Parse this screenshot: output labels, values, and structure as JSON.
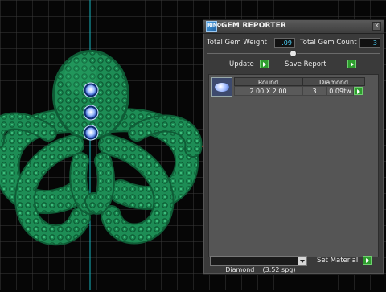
{
  "panel": {
    "title": "GEM REPORTER",
    "icon_text": "RINO\nGOLD",
    "close_label": "x",
    "stats": {
      "total_weight_label": "Total Gem Weight",
      "total_weight_value": ".09",
      "total_count_label": "Total Gem Count",
      "total_count_value": "3"
    },
    "buttons": {
      "update_label": "Update",
      "save_report_label": "Save Report",
      "set_material_label": "Set Material"
    },
    "table": {
      "headers": [
        "Round",
        "Diamond"
      ],
      "rows": [
        {
          "size": "2.00 X 2.00",
          "count": "3",
          "weight": "0.09tw"
        }
      ]
    },
    "material_select": {
      "value": "Diamond    (3.52 spg)"
    }
  },
  "colors": {
    "accent_button": "#2e9d2e",
    "value_text": "#4fd6ff",
    "model": "#1f8a52",
    "gems": "#9fc4ff"
  },
  "icons": [
    "gem-thumbnail-icon",
    "play-arrow-icon",
    "dropdown-arrow-icon",
    "close-icon",
    "slider-knob-icon"
  ]
}
